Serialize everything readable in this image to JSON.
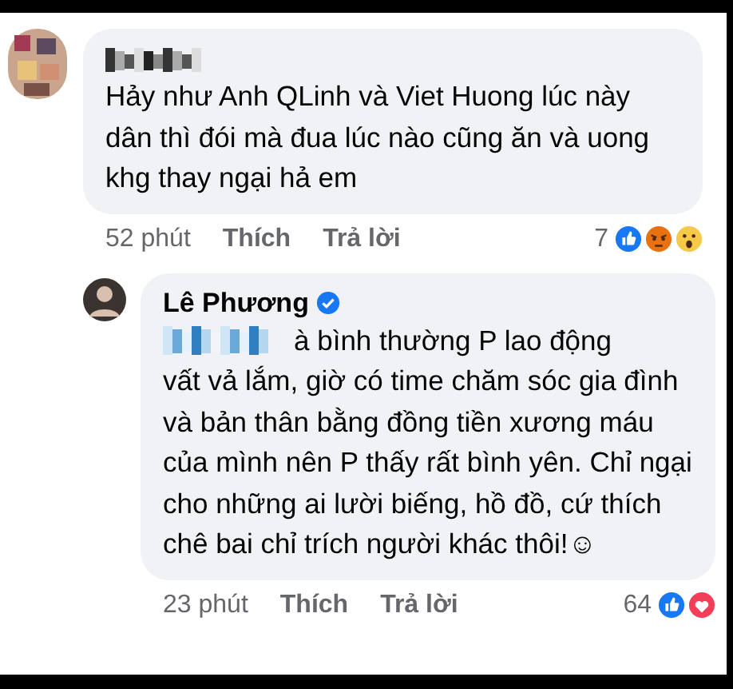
{
  "comments": [
    {
      "author_hidden": true,
      "text": "Hảy như Anh QLinh và Viet Huong lúc này dân thì đói mà đua lúc nào cũng ăn và uong khg thay ngại hả em",
      "time": "52 phút",
      "actions": [
        "Thích",
        "Trả lời"
      ],
      "reaction_count": "7",
      "reactions": [
        {
          "kind": "like"
        },
        {
          "kind": "angry"
        },
        {
          "kind": "wow"
        }
      ],
      "reply": false
    },
    {
      "author": "Lê Phương",
      "verified": true,
      "mention_hidden": true,
      "mention_text": "à bình thường P lao động",
      "text": "vất vả lắm, giờ có time chăm sóc gia đình và bản thân bằng đồng tiền xương máu của mình nên P thấy rất bình yên. Chỉ ngại cho những ai lười biếng, hồ đồ, cứ thích chê bai chỉ trích người khác thôi!☺",
      "time": "23 phút",
      "actions": [
        "Thích",
        "Trả lời"
      ],
      "reaction_count": "64",
      "reactions": [
        {
          "kind": "like"
        },
        {
          "kind": "love"
        }
      ],
      "reply": true
    }
  ]
}
